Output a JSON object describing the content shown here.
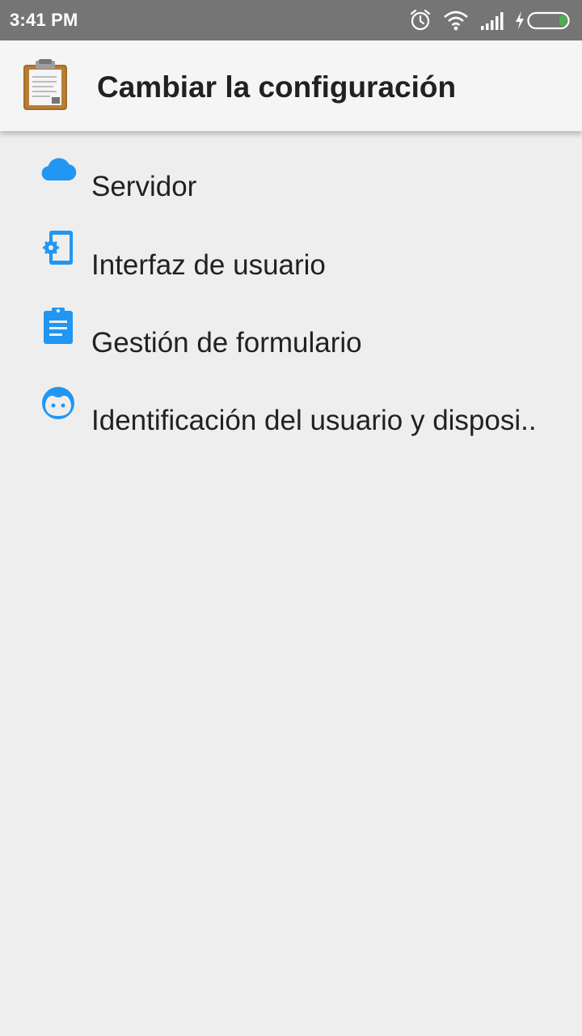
{
  "status_bar": {
    "time": "3:41 PM",
    "icons": [
      "alarm-icon",
      "wifi-icon",
      "cell-signal-icon",
      "charging-icon",
      "battery-icon"
    ],
    "battery_color": "#4caf50"
  },
  "app_bar": {
    "title": "Cambiar la configuración",
    "icon": "clipboard-icon"
  },
  "menu": {
    "icon_color": "#2196f3",
    "items": [
      {
        "label": "Servidor",
        "icon": "cloud-icon"
      },
      {
        "label": "Interfaz de usuario",
        "icon": "phone-settings-icon"
      },
      {
        "label": "Gestión de formulario",
        "icon": "clipboard-list-icon"
      },
      {
        "label": "Identificación del usuario y disposi..",
        "icon": "face-icon"
      }
    ]
  }
}
